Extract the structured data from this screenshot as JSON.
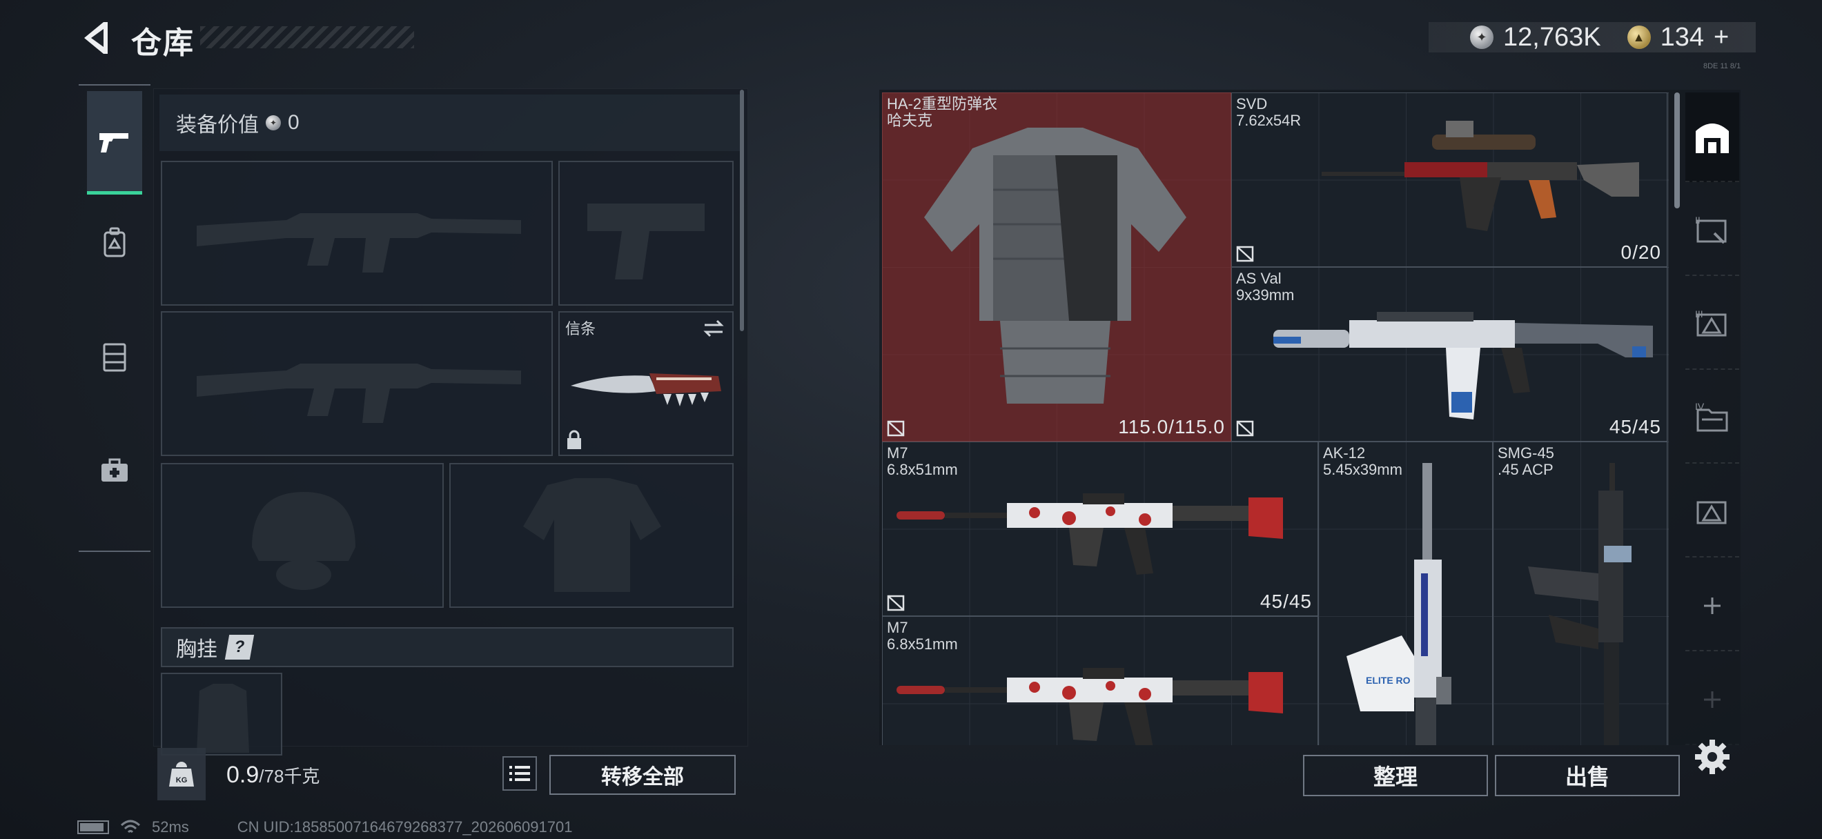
{
  "header": {
    "title": "仓库",
    "currency_silver": "12,763K",
    "currency_gold": "134",
    "gold_plus": "+",
    "build_tag": "8DE 11 8/1"
  },
  "colors": {
    "accent_green": "#3ad39a",
    "armor_bg": "#702a2c",
    "panel": "#161c24"
  },
  "left_rail": {
    "items": [
      "pistol-icon",
      "backpack-icon",
      "vest-icon",
      "medkit-icon"
    ],
    "active": "pistol-icon"
  },
  "loadout": {
    "value_label": "装备价值",
    "value": "0",
    "melee_label": "信条",
    "rig_label": "胸挂",
    "rig_help": "?",
    "weight_current": "0.9",
    "weight_max": "/78千克",
    "weight_badge": "KG",
    "transfer_all": "转移全部"
  },
  "stash": {
    "items": [
      {
        "id": "armor",
        "name": "HA-2重型防弹衣",
        "sub": "哈夫克",
        "count": "115.0/115.0"
      },
      {
        "id": "svd",
        "name": "SVD",
        "sub": "7.62x54R",
        "count": "0/20"
      },
      {
        "id": "asval",
        "name": "AS Val",
        "sub": "9x39mm",
        "count": "45/45"
      },
      {
        "id": "m7a",
        "name": "M7",
        "sub": "6.8x51mm",
        "count": "45/45"
      },
      {
        "id": "ak12",
        "name": "AK-12",
        "sub": "5.45x39mm",
        "count": ""
      },
      {
        "id": "smg45",
        "name": "SMG-45",
        "sub": ".45 ACP",
        "count": ""
      },
      {
        "id": "m7b",
        "name": "M7",
        "sub": "6.8x51mm",
        "count": ""
      }
    ],
    "ak12_sticker": "ELITE RO"
  },
  "actions": {
    "sort": "整理",
    "sell": "出售"
  },
  "status": {
    "ping": "52ms",
    "uid": "CN UID:18585007164679268377_202606091701"
  }
}
